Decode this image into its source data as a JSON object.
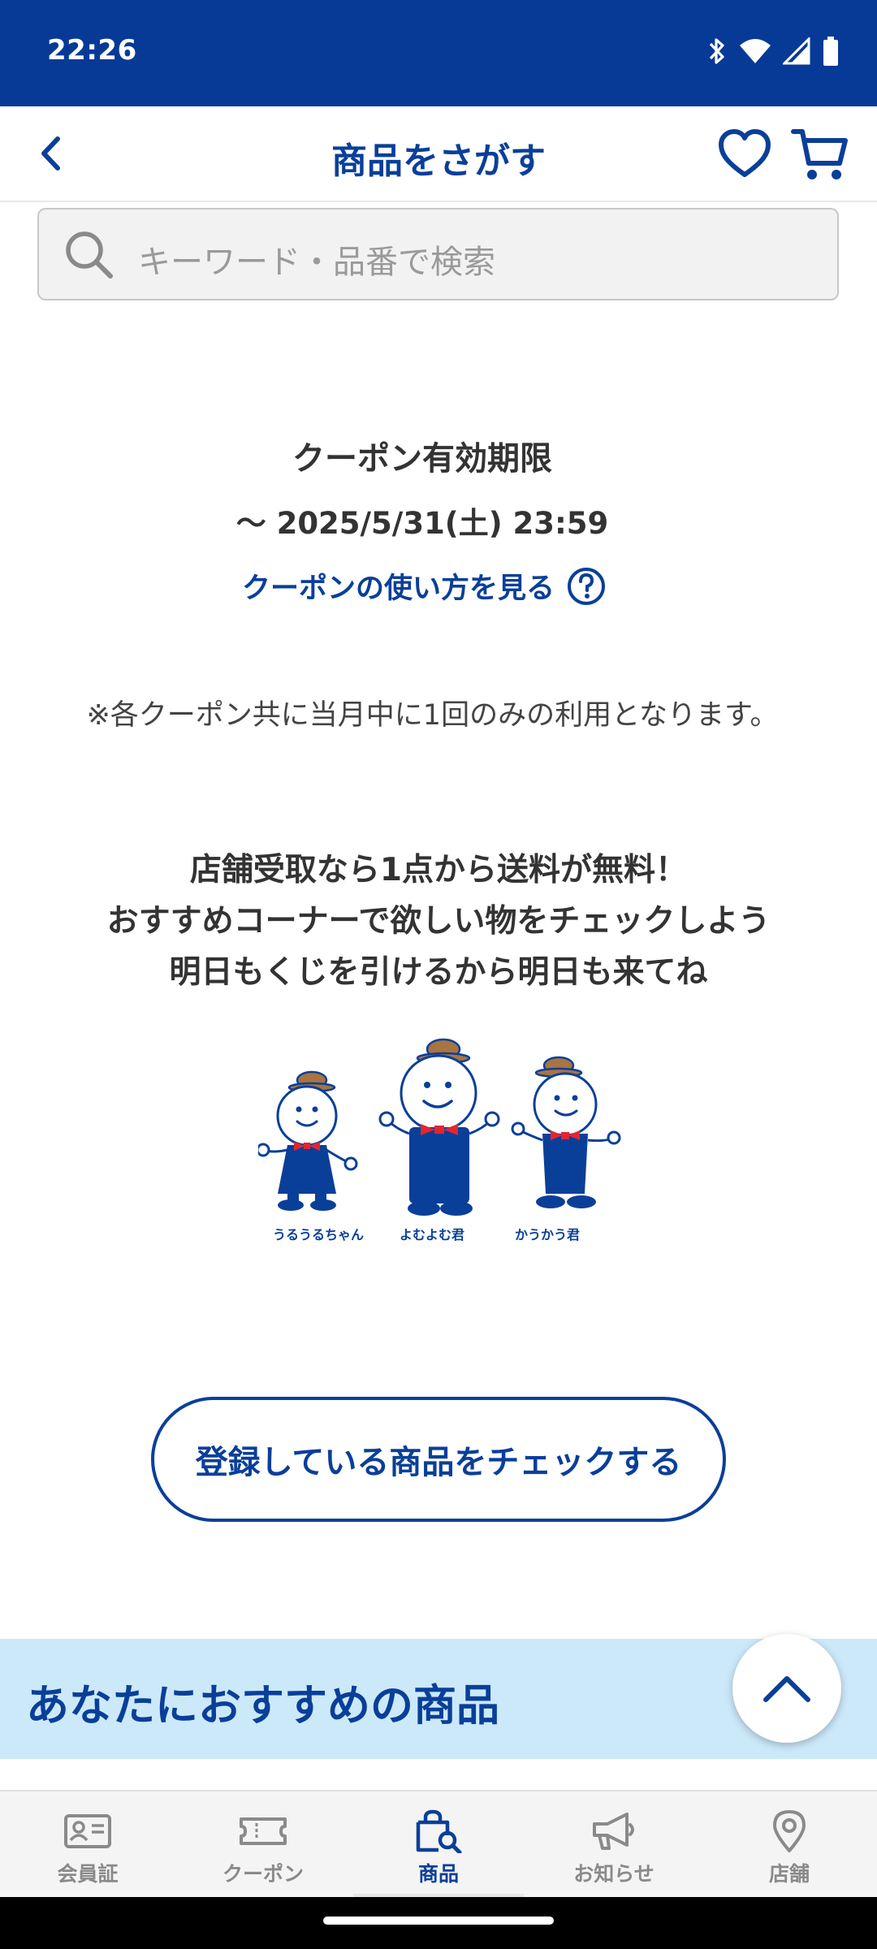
{
  "status_bar": {
    "time": "22:26"
  },
  "header": {
    "title": "商品をさがす"
  },
  "search": {
    "placeholder": "キーワード・品番で検索"
  },
  "coupon": {
    "expiry_title": "クーポン有効期限",
    "expiry_date": "〜 2025/5/31(土) 23:59",
    "howto_link": "クーポンの使い方を見る",
    "note": "※各クーポン共に当月中に1回のみの利用となります。"
  },
  "message": {
    "line1": "店舗受取なら1点から送料が無料！",
    "line2": "おすすめコーナーで欲しい物をチェックしよう",
    "line3": "明日もくじを引けるから明日も来てね"
  },
  "characters": {
    "names": [
      "うるうるちゃん",
      "よむよむ君",
      "かうかう君"
    ]
  },
  "check_button": {
    "label": "登録している商品をチェックする"
  },
  "recommend": {
    "title": "あなたにおすすめの商品"
  },
  "bottom_nav": {
    "items": [
      {
        "label": "会員証",
        "icon": "member-card-icon"
      },
      {
        "label": "クーポン",
        "icon": "ticket-icon"
      },
      {
        "label": "商品",
        "icon": "shopping-bag-search-icon",
        "active": true
      },
      {
        "label": "お知らせ",
        "icon": "megaphone-icon"
      },
      {
        "label": "店舗",
        "icon": "location-pin-icon"
      }
    ]
  },
  "colors": {
    "brand_blue": "#0a3f99",
    "status_bar": "#063a96",
    "recommend_band": "#cce9fa",
    "nav_inactive": "#8a8a8a",
    "bow_red": "#e2262f",
    "hat_brown": "#a87442"
  }
}
